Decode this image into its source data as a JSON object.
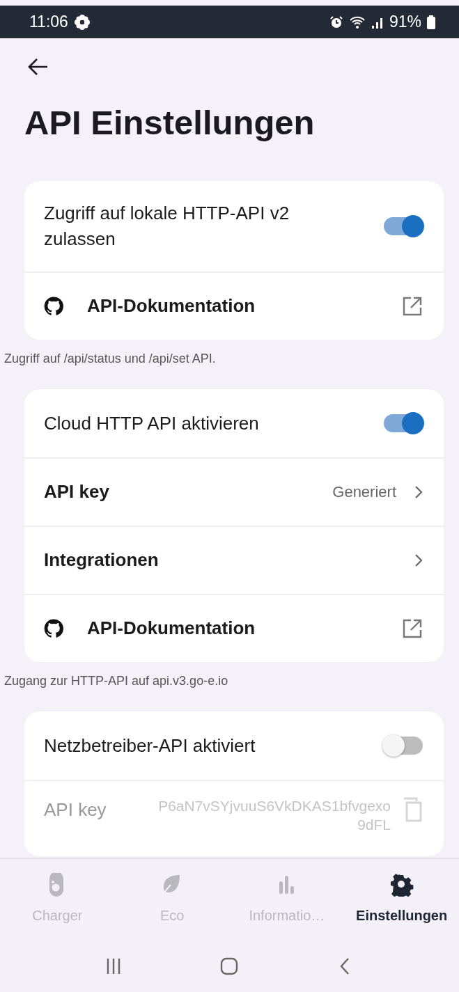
{
  "status_bar": {
    "time": "11:06",
    "battery": "91%"
  },
  "title": "API Einstellungen",
  "sections": [
    {
      "items": [
        {
          "kind": "toggle",
          "label": "Zugriff auf lokale HTTP-API v2 zulassen",
          "on": true
        },
        {
          "kind": "link",
          "label": "API-Dokumentation"
        }
      ],
      "caption": "Zugriff auf /api/status und /api/set API."
    },
    {
      "items": [
        {
          "kind": "toggle",
          "label": "Cloud HTTP API aktivieren",
          "on": true
        },
        {
          "kind": "nav",
          "label": "API key",
          "value": "Generiert"
        },
        {
          "kind": "nav",
          "label": "Integrationen"
        },
        {
          "kind": "link",
          "label": "API-Dokumentation"
        }
      ],
      "caption": "Zugang zur HTTP-API auf api.v3.go-e.io"
    },
    {
      "items": [
        {
          "kind": "toggle",
          "label": "Netzbetreiber-API aktiviert",
          "on": false
        },
        {
          "kind": "key",
          "label": "API key",
          "value": "P6aN7vSYjvuuS6VkDKAS1bfvgexo 9dFL",
          "disabled": true
        }
      ]
    }
  ],
  "bottom_nav": [
    {
      "label": "Charger",
      "selected": false
    },
    {
      "label": "Eco",
      "selected": false
    },
    {
      "label": "Informatio…",
      "selected": false
    },
    {
      "label": "Einstellungen",
      "selected": true
    }
  ]
}
